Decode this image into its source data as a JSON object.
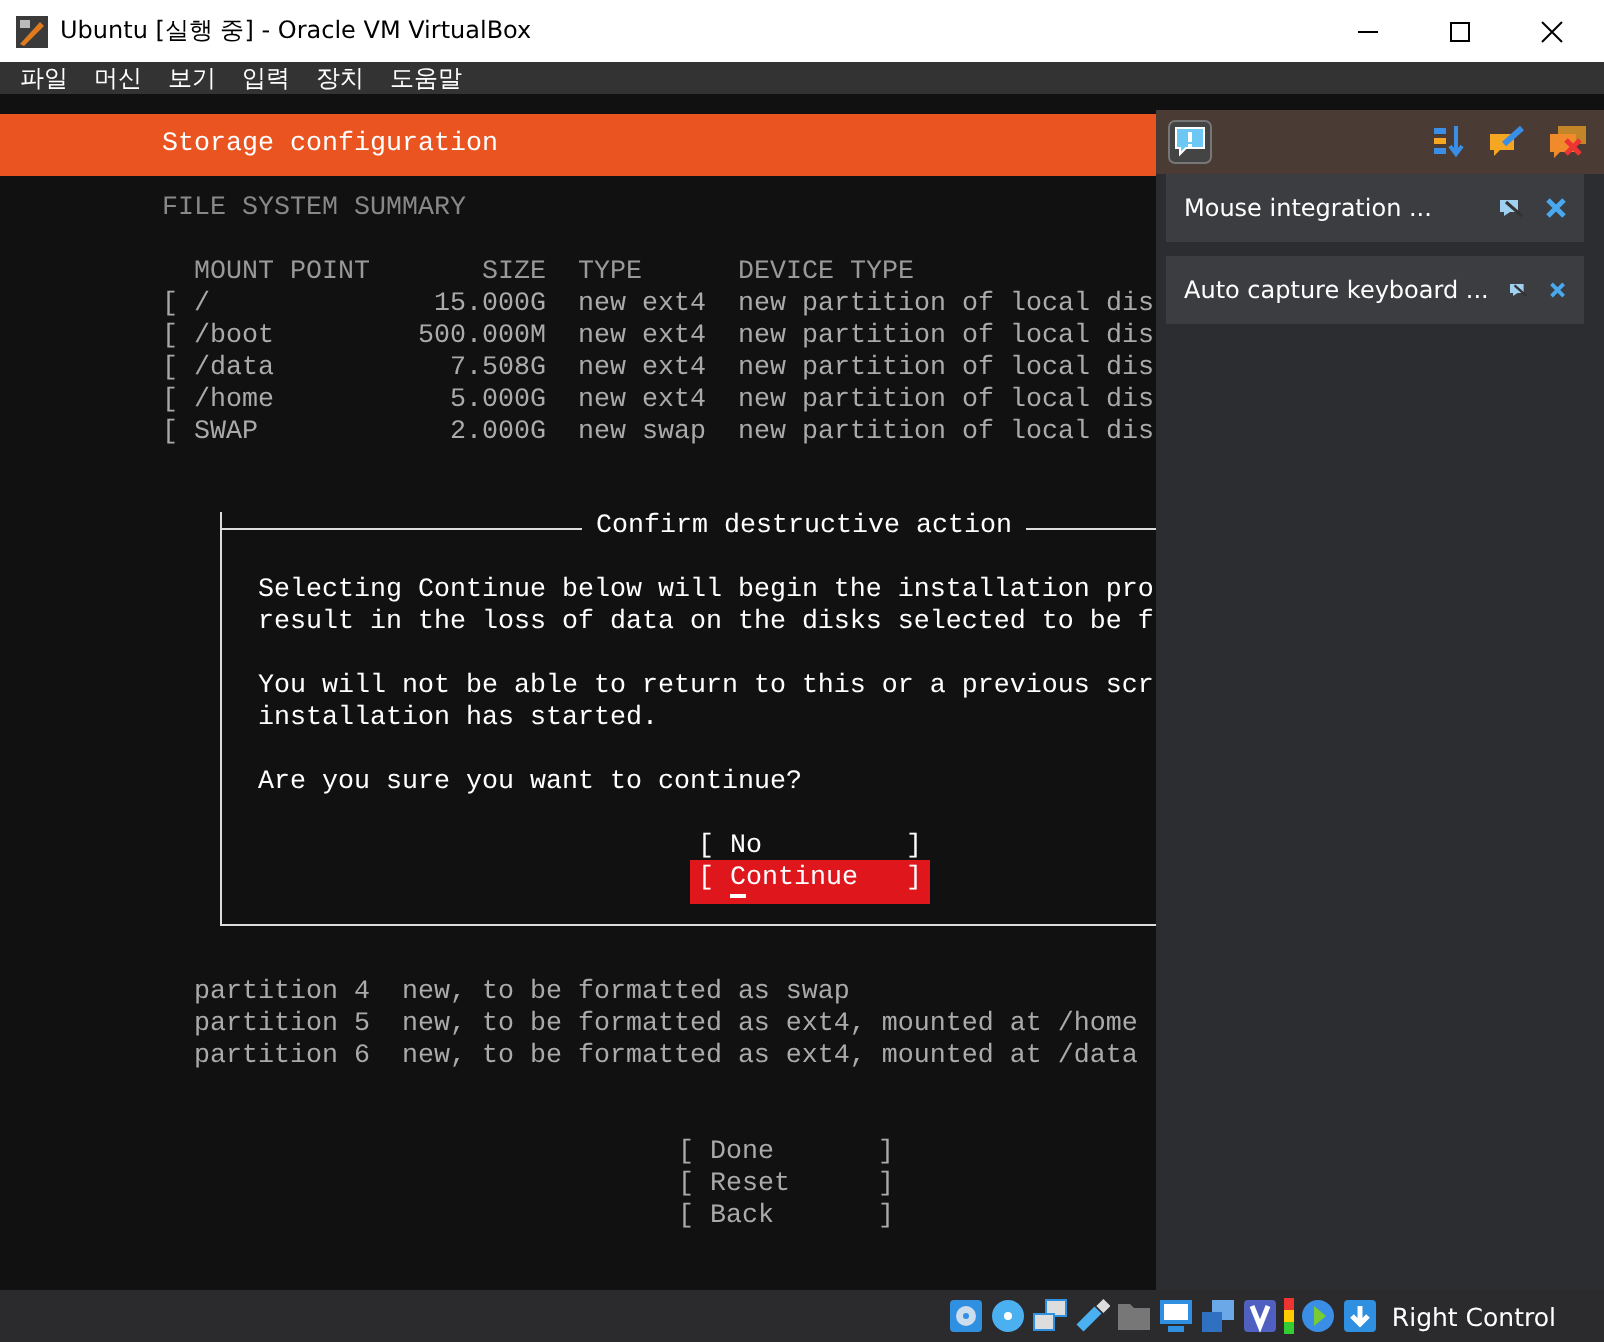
{
  "window": {
    "title": "Ubuntu [실행 중] - Oracle VM VirtualBox"
  },
  "menu": [
    "파일",
    "머신",
    "보기",
    "입력",
    "장치",
    "도움말"
  ],
  "installer": {
    "header": "Storage configuration",
    "section": "FILE SYSTEM SUMMARY",
    "columns": [
      "MOUNT POINT",
      "SIZE",
      "TYPE",
      "DEVICE TYPE"
    ],
    "rows": [
      {
        "bracket": "[",
        "mount": "/",
        "size": "15.000G",
        "type": "new ext4",
        "device": "new partition of local dis"
      },
      {
        "bracket": "[",
        "mount": "/boot",
        "size": "500.000M",
        "type": "new ext4",
        "device": "new partition of local dis"
      },
      {
        "bracket": "[",
        "mount": "/data",
        "size": "7.508G",
        "type": "new ext4",
        "device": "new partition of local dis"
      },
      {
        "bracket": "[",
        "mount": "/home",
        "size": "5.000G",
        "type": "new ext4",
        "device": "new partition of local dis"
      },
      {
        "bracket": "[",
        "mount": "SWAP",
        "size": "2.000G",
        "type": "new swap",
        "device": "new partition of local dis"
      }
    ],
    "partitions": [
      "partition 4  new, to be formatted as swap",
      "partition 5  new, to be formatted as ext4, mounted at /home",
      "partition 6  new, to be formatted as ext4, mounted at /data"
    ],
    "buttons": [
      {
        "open": "[",
        "label": "Done",
        "close": "]",
        "selected": false
      },
      {
        "open": "[",
        "label": "Reset",
        "close": "]",
        "selected": false
      },
      {
        "open": "[",
        "label": "Back",
        "close": "]",
        "selected": false
      }
    ]
  },
  "dialog": {
    "title": "Confirm destructive action",
    "paragraphs": [
      [
        "Selecting Continue below will begin the installation pro",
        "result in the loss of data on the disks selected to be f"
      ],
      [
        "You will not be able to return to this or a previous scr",
        "installation has started."
      ],
      [
        "Are you sure you want to continue?"
      ]
    ],
    "buttons": [
      {
        "open": "[",
        "label": "No",
        "close": "]",
        "selected": false
      },
      {
        "open": "[",
        "label": "Continue",
        "close": "]",
        "selected": true
      }
    ]
  },
  "notifications": [
    {
      "text": "Mouse integration ..."
    },
    {
      "text": "Auto capture keyboard ..."
    }
  ],
  "status_bar": {
    "host_key": "Right Control"
  }
}
